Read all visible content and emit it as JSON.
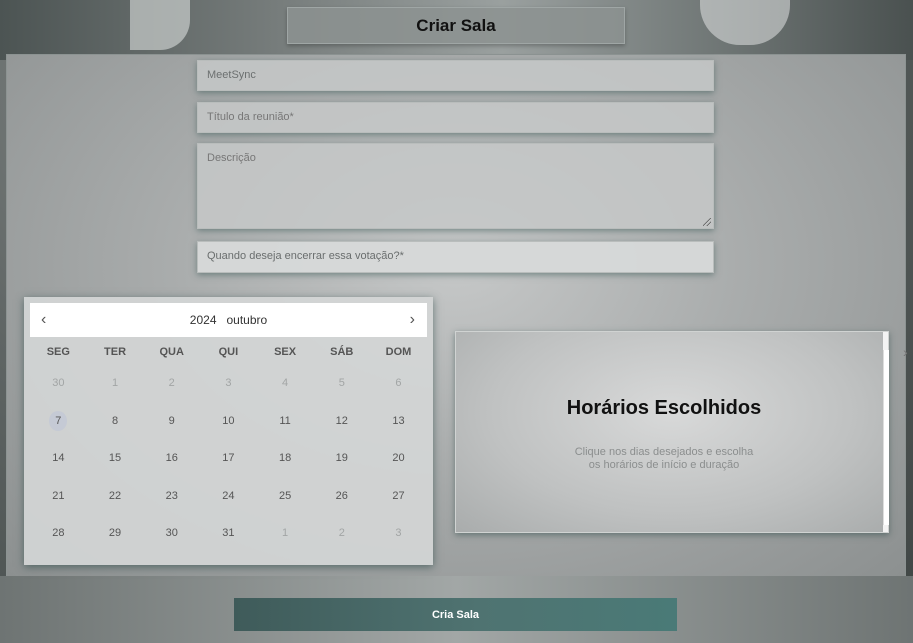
{
  "header": {
    "title": "Criar Sala"
  },
  "form": {
    "app_field_value": "MeetSync",
    "title_placeholder": "Título da reunião*",
    "description_placeholder": "Descrição",
    "end_vote_placeholder": "Quando deseja encerrar essa votação?*"
  },
  "calendar": {
    "year": "2024",
    "month": "outubro",
    "prev_icon": "chevron-left-icon",
    "next_icon": "chevron-right-icon",
    "weekdays": [
      "SEG",
      "TER",
      "QUA",
      "QUI",
      "SEX",
      "SÁB",
      "DOM"
    ],
    "days": [
      {
        "label": "30",
        "muted": true
      },
      {
        "label": "1",
        "muted": true
      },
      {
        "label": "2",
        "muted": true
      },
      {
        "label": "3",
        "muted": true
      },
      {
        "label": "4",
        "muted": true
      },
      {
        "label": "5",
        "muted": true
      },
      {
        "label": "6",
        "muted": true
      },
      {
        "label": "7",
        "muted": false,
        "today": true
      },
      {
        "label": "8",
        "muted": false
      },
      {
        "label": "9",
        "muted": false
      },
      {
        "label": "10",
        "muted": false
      },
      {
        "label": "11",
        "muted": false
      },
      {
        "label": "12",
        "muted": false
      },
      {
        "label": "13",
        "muted": false
      },
      {
        "label": "14",
        "muted": false
      },
      {
        "label": "15",
        "muted": false
      },
      {
        "label": "16",
        "muted": false
      },
      {
        "label": "17",
        "muted": false
      },
      {
        "label": "18",
        "muted": false
      },
      {
        "label": "19",
        "muted": false
      },
      {
        "label": "20",
        "muted": false
      },
      {
        "label": "21",
        "muted": false
      },
      {
        "label": "22",
        "muted": false
      },
      {
        "label": "23",
        "muted": false
      },
      {
        "label": "24",
        "muted": false
      },
      {
        "label": "25",
        "muted": false
      },
      {
        "label": "26",
        "muted": false
      },
      {
        "label": "27",
        "muted": false
      },
      {
        "label": "28",
        "muted": false
      },
      {
        "label": "29",
        "muted": false
      },
      {
        "label": "30",
        "muted": false
      },
      {
        "label": "31",
        "muted": false
      },
      {
        "label": "1",
        "muted": true
      },
      {
        "label": "2",
        "muted": true
      },
      {
        "label": "3",
        "muted": true
      }
    ]
  },
  "schedule": {
    "title": "Horários Escolhidos",
    "hint_line1": "Clique nos dias desejados e escolha",
    "hint_line2": "os horários de início e duração"
  },
  "submit_label": "Cria Sala",
  "colors": {
    "accent": "#4a7371",
    "panel": "#b3b6b6"
  }
}
